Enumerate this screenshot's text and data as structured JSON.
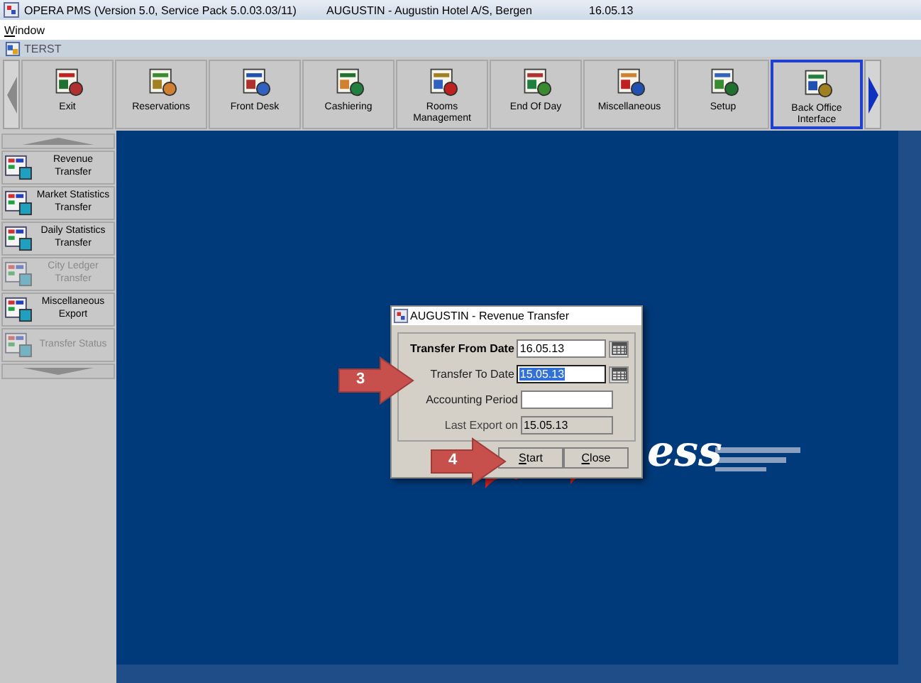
{
  "window": {
    "title": "OPERA PMS (Version 5.0, Service Pack 5.0.03.03/11)",
    "property": "AUGUSTIN - Augustin Hotel A/S, Bergen",
    "date": "16.05.13"
  },
  "menu": [
    {
      "label": "Window"
    }
  ],
  "module_bar": {
    "title": "TERST"
  },
  "toolbar": [
    {
      "label": "Exit",
      "selected": false
    },
    {
      "label": "Reservations",
      "selected": false
    },
    {
      "label": "Front Desk",
      "selected": false
    },
    {
      "label": "Cashiering",
      "selected": false
    },
    {
      "label": "Rooms Management",
      "selected": false
    },
    {
      "label": "End Of Day",
      "selected": false
    },
    {
      "label": "Miscellaneous",
      "selected": false
    },
    {
      "label": "Setup",
      "selected": false
    },
    {
      "label": "Back Office Interface",
      "selected": true
    }
  ],
  "sidebar": {
    "items": [
      {
        "label": "Revenue Transfer",
        "disabled": false
      },
      {
        "label": "Market Statistics Transfer",
        "disabled": false
      },
      {
        "label": "Daily Statistics Transfer",
        "disabled": false
      },
      {
        "label": "City Ledger Transfer",
        "disabled": true
      },
      {
        "label": "Miscellaneous Export",
        "disabled": false
      },
      {
        "label": "Transfer Status",
        "disabled": true
      }
    ]
  },
  "background_logo": {
    "text": "ess"
  },
  "dialog": {
    "title": "AUGUSTIN - Revenue Transfer",
    "fields": [
      {
        "label": "Transfer From Date",
        "value": "16.05.13",
        "required": true,
        "calendar": true,
        "selected": false,
        "disabled": false
      },
      {
        "label": "Transfer To Date",
        "value": "15.05.13",
        "required": false,
        "calendar": true,
        "selected": true,
        "disabled": false
      },
      {
        "label": "Accounting Period",
        "required": false,
        "calendar": false,
        "selected": false,
        "disabled": false
      },
      {
        "label": "Last Export on",
        "value": "15.05.13",
        "required": false,
        "calendar": false,
        "selected": false,
        "disabled": true
      }
    ],
    "buttons": [
      {
        "label": "Start"
      },
      {
        "label": "Close"
      }
    ]
  },
  "callouts": [
    {
      "label": "3"
    },
    {
      "label": "4"
    }
  ]
}
